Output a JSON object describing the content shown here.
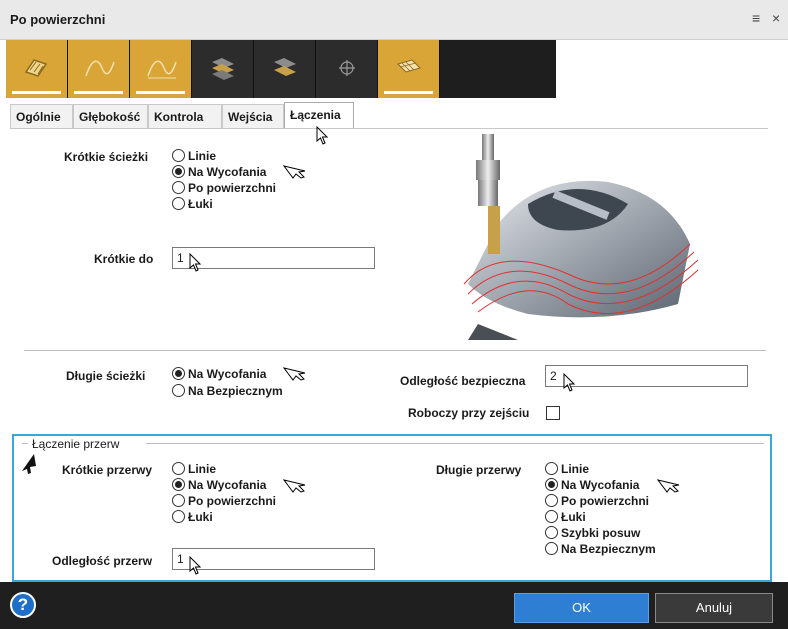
{
  "window": {
    "title": "Po powierzchni",
    "menu_icon": "≡",
    "close_icon": "×"
  },
  "toolbar": {
    "buttons": [
      {
        "icon": "surface-pattern-icon",
        "active": true
      },
      {
        "icon": "curve-icon",
        "active": true
      },
      {
        "icon": "curve-icon",
        "active": true
      },
      {
        "icon": "layers-icon",
        "active": false
      },
      {
        "icon": "layers-icon",
        "active": false
      },
      {
        "icon": "crosshair-icon",
        "active": false
      },
      {
        "icon": "surface-grid-icon",
        "active": true
      }
    ]
  },
  "tabs": [
    "Ogólnie",
    "Głębokość",
    "Kontrola",
    "Wejścia",
    "Łączenia"
  ],
  "active_tab": "Łączenia",
  "short_paths": {
    "label": "Krótkie ścieżki",
    "options": [
      "Linie",
      "Na Wycofania",
      "Po powierzchni",
      "Łuki"
    ],
    "selected": "Na Wycofania"
  },
  "short_to": {
    "label": "Krótkie do",
    "value": "1"
  },
  "long_paths": {
    "label": "Długie ścieżki",
    "options": [
      "Na Wycofania",
      "Na Bezpiecznym"
    ],
    "selected": "Na Wycofania"
  },
  "safe_distance": {
    "label": "Odległość bezpieczna",
    "value": "2"
  },
  "work_exit": {
    "label": "Roboczy przy zejściu",
    "checked": false
  },
  "gap_linking": {
    "title": "Łączenie przerw",
    "short_gaps": {
      "label": "Krótkie przerwy",
      "options": [
        "Linie",
        "Na Wycofania",
        "Po powierzchni",
        "Łuki"
      ],
      "selected": "Na Wycofania"
    },
    "long_gaps": {
      "label": "Długie przerwy",
      "options": [
        "Linie",
        "Na Wycofania",
        "Po powierzchni",
        "Łuki",
        "Szybki posuw",
        "Na Bezpiecznym"
      ],
      "selected": "Na Wycofania"
    },
    "gap_distance": {
      "label": "Odległość przerw",
      "value": "1"
    }
  },
  "footer": {
    "help": "?",
    "ok": "OK",
    "cancel": "Anuluj"
  },
  "colors": {
    "accent_gold": "#d9a536",
    "toolbar_dark": "#1e1e1e",
    "group_border": "#38a8d6",
    "ok_blue": "#2e7fd3"
  }
}
